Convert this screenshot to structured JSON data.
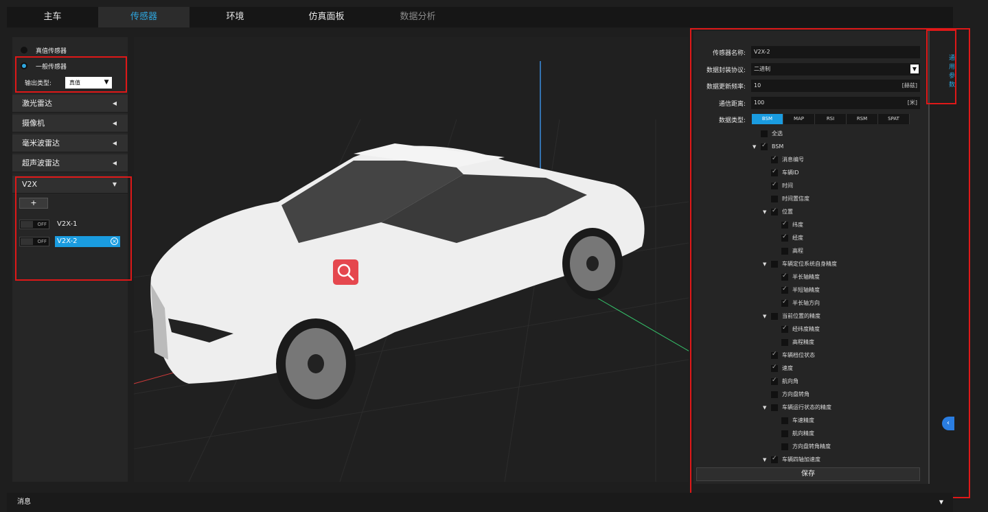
{
  "tabs": [
    {
      "label": "主车"
    },
    {
      "label": "传感器"
    },
    {
      "label": "环境"
    },
    {
      "label": "仿真面板"
    },
    {
      "label": "数据分析"
    }
  ],
  "left": {
    "radio_true": "真值传感器",
    "radio_general": "一般传感器",
    "output_type_label": "输出类型:",
    "output_type_value": "真值",
    "groups": [
      "激光雷达",
      "摄像机",
      "毫米波雷达",
      "超声波雷达"
    ],
    "v2x_group": "V2X",
    "add_label": "+",
    "toggle_label": "OFF",
    "v2x_items": [
      "V2X-1",
      "V2X-2"
    ]
  },
  "form": {
    "name_label": "传感器名称:",
    "name_value": "V2X-2",
    "protocol_label": "数据封装协议:",
    "protocol_value": "二进制",
    "freq_label": "数据更新频率:",
    "freq_value": "10",
    "freq_unit": "[赫兹]",
    "dist_label": "通信距离:",
    "dist_value": "100",
    "dist_unit": "[米]",
    "type_label": "数据类型:",
    "data_tabs": [
      "BSM",
      "MAP",
      "RSI",
      "RSM",
      "SPAT"
    ],
    "select_all": "全选",
    "tree": [
      {
        "label": "BSM",
        "level": 0,
        "expand": true,
        "checked": true
      },
      {
        "label": "消息编号",
        "level": 1,
        "checked": true
      },
      {
        "label": "车辆ID",
        "level": 1,
        "checked": true
      },
      {
        "label": "时间",
        "level": 1,
        "checked": true
      },
      {
        "label": "时间置信度",
        "level": 1,
        "checked": false
      },
      {
        "label": "位置",
        "level": 1,
        "expand": true,
        "checked": true
      },
      {
        "label": "纬度",
        "level": 2,
        "checked": true
      },
      {
        "label": "经度",
        "level": 2,
        "checked": true
      },
      {
        "label": "高程",
        "level": 2,
        "checked": false
      },
      {
        "label": "车辆定位系统自身精度",
        "level": 1,
        "expand": true,
        "checked": false
      },
      {
        "label": "半长轴精度",
        "level": 2,
        "checked": true
      },
      {
        "label": "半短轴精度",
        "level": 2,
        "checked": true
      },
      {
        "label": "半长轴方向",
        "level": 2,
        "checked": true
      },
      {
        "label": "当前位置的精度",
        "level": 1,
        "expand": true,
        "checked": false
      },
      {
        "label": "经纬度精度",
        "level": 2,
        "checked": true
      },
      {
        "label": "高程精度",
        "level": 2,
        "checked": false
      },
      {
        "label": "车辆档位状态",
        "level": 1,
        "checked": true
      },
      {
        "label": "速度",
        "level": 1,
        "checked": true
      },
      {
        "label": "航向角",
        "level": 1,
        "checked": true
      },
      {
        "label": "方向盘转角",
        "level": 1,
        "checked": false
      },
      {
        "label": "车辆运行状态的精度",
        "level": 1,
        "expand": true,
        "checked": false
      },
      {
        "label": "车速精度",
        "level": 2,
        "checked": false
      },
      {
        "label": "航向精度",
        "level": 2,
        "checked": false
      },
      {
        "label": "方向盘转角精度",
        "level": 2,
        "checked": false
      },
      {
        "label": "车辆四轴加速度",
        "level": 1,
        "expand": true,
        "checked": true
      }
    ],
    "save_label": "保存"
  },
  "side_tab": "通用参数",
  "bottom": {
    "label": "消息"
  },
  "colors": {
    "accent": "#2ea7e0",
    "highlight_box": "#e01818",
    "selected_bg": "#1a9ce0"
  }
}
